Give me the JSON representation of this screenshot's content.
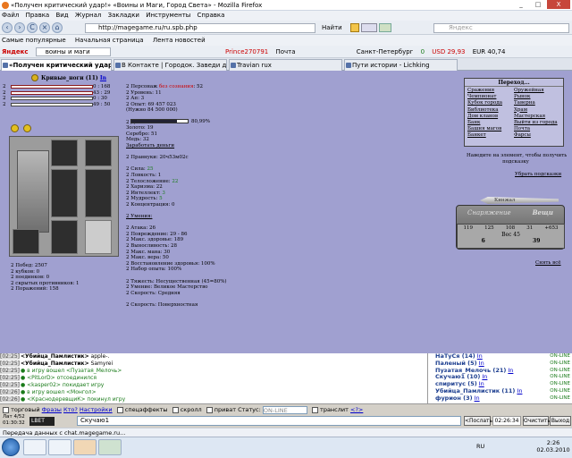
{
  "window": {
    "title": "«Получен критический удар!» «Воины и Маги, Город Света» - Mozilla Firefox",
    "min": "_",
    "max": "□",
    "close": "X"
  },
  "menu": [
    "Файл",
    "Правка",
    "Вид",
    "Журнал",
    "Закладки",
    "Инструменты",
    "Справка"
  ],
  "nav": {
    "back": "‹",
    "forward": "›",
    "reload": "C",
    "stop": "×",
    "home": "⌂",
    "url": "http://magegame.ru/ru.spb.php",
    "find_label": "Найти",
    "search_placeholder": "Яндекс"
  },
  "bookmarks": [
    "Самые популярные",
    "Начальная страница",
    "Лента новостей"
  ],
  "yandex": {
    "logo": "Яндекс",
    "query": "воины и маги",
    "prince": "Prince270791",
    "mail": "Почта",
    "city": "Санкт-Петербург",
    "weather": "0",
    "usd": "USD 29,93",
    "eur": "EUR 40,74"
  },
  "tabs": [
    {
      "label": "«Получен критический удар!»«..."
    },
    {
      "label": "В Контакте | Городок. Заведи друз..."
    },
    {
      "label": "Travian rux"
    },
    {
      "label": "Пути истории - Lichking"
    }
  ],
  "game": {
    "hp_bars": [
      {
        "value": "0 : 168"
      },
      {
        "value": "43 : 29"
      },
      {
        "value": "0 : 30"
      },
      {
        "value": "49 : 50"
      }
    ],
    "bar_labels": [
      "2",
      "2",
      "2",
      "2"
    ],
    "name": "Кривые_ноги (11)",
    "name_suffix": "In",
    "left_stats": [
      "2 Побед: 2507",
      "2 кубков: 0",
      "2 поединков: 0",
      "2 скрытых противников: 1",
      "2 Поражений: 158"
    ],
    "mid_stats": [
      {
        "t": "2 Персонаж ",
        "r": "без сознания",
        "e": ": 52"
      },
      {
        "t": "2 Уровень: 11"
      },
      {
        "t": "2 Ап: 3"
      },
      {
        "t": "2 Опыт: 69 457 023"
      },
      {
        "t": "   (Нужно 84 500 000)"
      },
      {
        "t": ""
      },
      {
        "t": "2 Деньги:"
      },
      {
        "t": "       Золото: 19"
      },
      {
        "t": "       Серебро: 51"
      },
      {
        "t": "       Медь: 32"
      },
      {
        "t": "Заработать деньги",
        "u": true
      },
      {
        "t": ""
      },
      {
        "t": "2 Правнуки: 20ч53м02с"
      },
      {
        "t": ""
      },
      {
        "t": "2 Сила: ",
        "g": "25"
      },
      {
        "t": "2 Ловкость: 1"
      },
      {
        "t": "2 Телосложение: ",
        "g": "22"
      },
      {
        "t": "2 Харизма: 22"
      },
      {
        "t": "2 Интеллект: ",
        "g": "3"
      },
      {
        "t": "2 Мудрость: ",
        "g": "5"
      },
      {
        "t": "2 Концентрация: 0"
      },
      {
        "t": ""
      },
      {
        "t": "2 Умения:",
        "u": true
      },
      {
        "t": ""
      },
      {
        "t": "2 Атака: 26"
      },
      {
        "t": "2 Повреждение: 29 - 86"
      },
      {
        "t": "2 Макс. здоровье: 189"
      },
      {
        "t": "2 Выносливость: 28"
      },
      {
        "t": "2 Макс. мана: 30"
      },
      {
        "t": "2 Макс. вера: 50"
      },
      {
        "t": "2 Восстановление здоровья: 100%"
      },
      {
        "t": "2 Набор опыта: 100%"
      },
      {
        "t": ""
      },
      {
        "t": "2 Тяжесть: Несущественная (45=80%)"
      },
      {
        "t": "2 Умение: Великое Мастерство"
      },
      {
        "t": "2 Скорость: Средняя"
      },
      {
        "t": ""
      },
      {
        "t": "2 Скорость: Поверхностная"
      }
    ],
    "progress": {
      "label": "80,99%",
      "fraction": 0.8099
    },
    "transitions": {
      "header": "Переход...",
      "items": [
        "Сражения",
        "Оружейная",
        "Чемпионат",
        "Рынок",
        "Кубок города",
        "Таверна",
        "Библиотека",
        "Храм",
        "Дом кланов",
        "Мастерская",
        "Банк",
        "Выйти из города",
        "Башня магов",
        "Почта",
        "Банкет",
        "Фарсы"
      ]
    },
    "hint_text": [
      "Наведите на элемент, чтобы получить",
      "подсказку"
    ],
    "hide_hints": "Убрать подсказки",
    "sword_label": "Кинжал",
    "badge": {
      "left": "Снаряжение",
      "right": "Вещи",
      "weight": "Вес 45",
      "nums": [
        "119",
        "125",
        "108",
        "31",
        "+653"
      ],
      "low": [
        "6",
        "39"
      ]
    },
    "all_link": "Снять всё"
  },
  "chat": [
    {
      "time": "[02:25]",
      "who": "<Убийца_Памлистик>",
      "msg": " apple-. "
    },
    {
      "time": "[02:25]",
      "who": "<Убийца_Памлистик>",
      "msg": " Samyrei "
    },
    {
      "time": "[02:25]",
      "who": "",
      "msg": "● в игру вошел <Пузатая_Мелочь>"
    },
    {
      "time": "[02:25]",
      "who": "",
      "msg": "● <PitLorD> отсоединился"
    },
    {
      "time": "[02:25]",
      "who": "",
      "msg": "● <kasper02> покидает игру"
    },
    {
      "time": "[02:26]",
      "who": "",
      "msg": "● в игру вошел <Монгол>"
    },
    {
      "time": "[02:26]",
      "who": "",
      "msg": "● <КраснодеревщиК> покинул игру"
    }
  ],
  "users": [
    {
      "name": "НаТуСя (14)",
      "tag": "In",
      "status": "ON-LINE"
    },
    {
      "name": "Паленый (5)",
      "tag": "In",
      "status": "ON-LINE"
    },
    {
      "name": "Пузатая_Мелочь (21)",
      "tag": "In",
      "status": "ON-LINE"
    },
    {
      "name": "Скучаю1 (10)",
      "tag": "In",
      "status": "ON-LINE"
    },
    {
      "name": "спиритус (5)",
      "tag": "In",
      "status": "ON-LINE"
    },
    {
      "name": "Убийца_Памлистик (11)",
      "tag": "In",
      "status": "ON-LINE"
    },
    {
      "name": "фурион (3)",
      "tag": "In",
      "status": "ON-LINE"
    }
  ],
  "controls": {
    "a": "торговый",
    "b": "Фразы",
    "c": "Кто?",
    "d": "Настройки",
    "e": "спецэффекты",
    "f": "скролл",
    "g": "приват",
    "status_label": "Статус:",
    "status_value": "ON-LINE",
    "h": "транслит",
    "i": "<?>"
  },
  "input": {
    "left_info_1": "Лат 4/52",
    "left_info_2": "01:30:32",
    "channel": "LBET",
    "value": "Скучаю1",
    "send": "<Послать",
    "time": "02:26:34",
    "clear": "Очистить",
    "exit": "Выход"
  },
  "status": "Передача данных с chat.magegame.ru...",
  "tray": {
    "lang": "RU",
    "time": "2:26",
    "date": "02.03.2010"
  }
}
